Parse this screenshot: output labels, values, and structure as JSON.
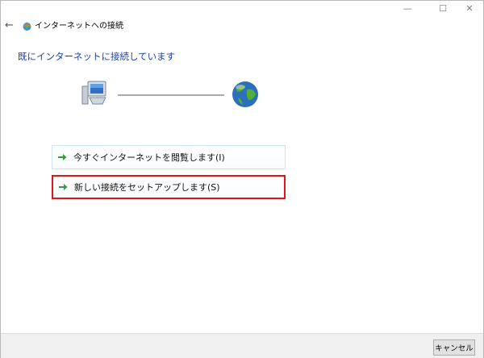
{
  "header": {
    "title": "インターネットへの接続"
  },
  "window_controls": {
    "minimize": "—",
    "maximize": "☐",
    "close": "✕"
  },
  "main": {
    "heading": "既にインターネットに接続しています",
    "options": [
      {
        "label": "今すぐインターネットを閲覧します(I)"
      },
      {
        "label": "新しい接続をセットアップします(S)",
        "highlighted": true
      }
    ]
  },
  "footer": {
    "cancel_label": "キャンセル"
  },
  "colors": {
    "heading": "#1c3fb0",
    "highlight_border": "#e0141c",
    "arrow": "#2e9e3a"
  },
  "icons": [
    "back-arrow-icon",
    "network-icon",
    "computer-icon",
    "globe-icon",
    "green-arrow-icon"
  ]
}
